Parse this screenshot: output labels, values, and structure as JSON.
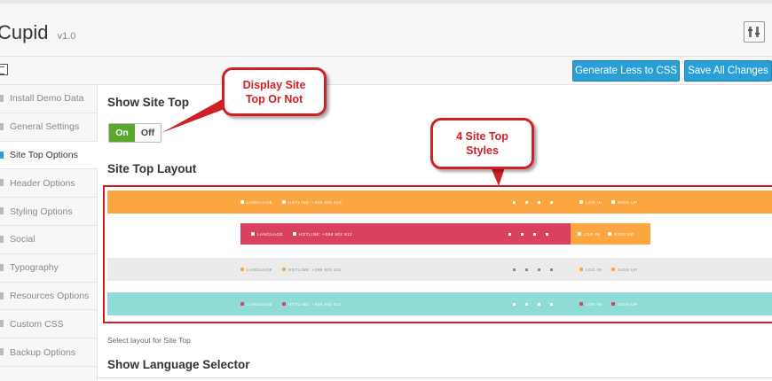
{
  "header": {
    "app_name": "Cupid",
    "version": "v1.0",
    "tools_icon": "tools-icon"
  },
  "toolbar": {
    "generate_label": "Generate Less to CSS",
    "save_label": "Save All Changes",
    "toggle_icon": "panel-toggle-icon"
  },
  "sidebar": {
    "items": [
      {
        "label": "Install Demo Data",
        "active": false
      },
      {
        "label": "General Settings",
        "active": false
      },
      {
        "label": "Site Top Options",
        "active": true
      },
      {
        "label": "Header Options",
        "active": false
      },
      {
        "label": "Styling Options",
        "active": false
      },
      {
        "label": "Social",
        "active": false
      },
      {
        "label": "Typography",
        "active": false
      },
      {
        "label": "Resources Options",
        "active": false
      },
      {
        "label": "Custom CSS",
        "active": false
      },
      {
        "label": "Backup Options",
        "active": false
      }
    ]
  },
  "main": {
    "show_site_top_title": "Show Site Top",
    "toggle": {
      "on_label": "On",
      "off_label": "Off",
      "value": "On"
    },
    "layout_title": "Site Top Layout",
    "layouts": [
      {
        "language": "LANGUAGE",
        "hotline": "HOTLINE: +098 902 912",
        "login": "LOG IN",
        "signup": "SIGN UP",
        "color": "#fba640"
      },
      {
        "language": "LANGUAGE",
        "hotline": "HOTLINE: +098 902 912",
        "login": "LOG IN",
        "signup": "SIGN UP",
        "color": "#d9415f"
      },
      {
        "language": "LANGUAGE",
        "hotline": "HOTLINE: +098 902 912",
        "login": "LOG IN",
        "signup": "SIGN UP",
        "color": "#ebebeb"
      },
      {
        "language": "LANGUAGE",
        "hotline": "HOTLINE: +098 902 912",
        "login": "LOG IN",
        "signup": "SIGN UP",
        "color": "#8fdcd7"
      }
    ],
    "helper_text": "Select layout for Site Top",
    "language_selector_title": "Show Language Selector"
  },
  "callouts": {
    "display_line1": "Display Site",
    "display_line2": "Top Or Not",
    "styles_line1": "4 Site Top",
    "styles_line2": "Styles"
  },
  "colors": {
    "accent": "#2a9fd6",
    "toggle_on": "#5aa72e",
    "callout_red": "#d21f26"
  }
}
